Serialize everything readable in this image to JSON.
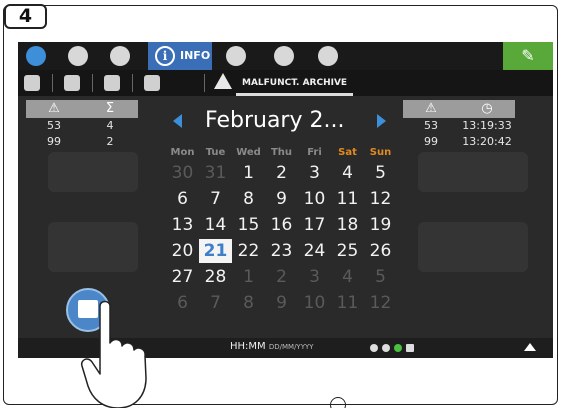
{
  "step_badge": "4",
  "topbar": {
    "info_label": "INFO"
  },
  "subbar": {
    "tab_label": "MALFUNCT. ARCHIVE"
  },
  "left_table": {
    "headers": [
      "⚠",
      "Σ"
    ],
    "rows": [
      [
        "53",
        "4"
      ],
      [
        "99",
        "2"
      ]
    ]
  },
  "right_table": {
    "headers": [
      "⚠",
      "◷"
    ],
    "rows": [
      [
        "53",
        "13:19:33"
      ],
      [
        "99",
        "13:20:42"
      ]
    ]
  },
  "calendar": {
    "month": "February 2...",
    "weekdays": [
      "Mon",
      "Tue",
      "Wed",
      "Thu",
      "Fri",
      "Sat",
      "Sun"
    ],
    "weeks": [
      [
        "30",
        "31",
        "1",
        "2",
        "3",
        "4",
        "5"
      ],
      [
        "6",
        "7",
        "8",
        "9",
        "10",
        "11",
        "12"
      ],
      [
        "13",
        "14",
        "15",
        "16",
        "17",
        "18",
        "19"
      ],
      [
        "20",
        "21",
        "22",
        "23",
        "24",
        "25",
        "26"
      ],
      [
        "27",
        "28",
        "1",
        "2",
        "3",
        "4",
        "5"
      ],
      [
        "6",
        "7",
        "8",
        "9",
        "10",
        "11",
        "12"
      ]
    ],
    "selected_day": "21"
  },
  "bottombar": {
    "time": "HH:MM",
    "date_format": "DD/MM/YYYY"
  },
  "colors": {
    "accent_blue": "#3d8fd9",
    "info_tab": "#3a6fb8",
    "wrench_green": "#58a83a",
    "weekend_orange": "#e08a20"
  }
}
